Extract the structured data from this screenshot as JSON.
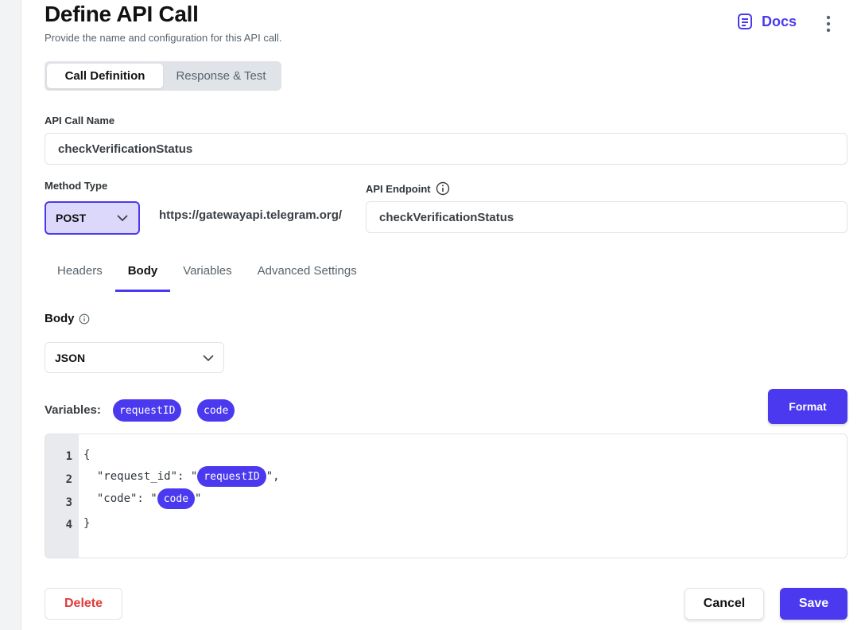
{
  "header": {
    "title": "Define API Call",
    "subtitle": "Provide the name and configuration for this API call.",
    "docs_label": "Docs"
  },
  "main_tabs": [
    {
      "label": "Call Definition",
      "active": true
    },
    {
      "label": "Response & Test",
      "active": false
    }
  ],
  "api_call_name": {
    "label": "API Call Name",
    "value": "checkVerificationStatus"
  },
  "method": {
    "label": "Method Type",
    "value": "POST"
  },
  "base_url": "https://gatewayapi.telegram.org/",
  "endpoint": {
    "label": "API Endpoint",
    "value": "checkVerificationStatus"
  },
  "sub_tabs": [
    {
      "label": "Headers",
      "active": false
    },
    {
      "label": "Body",
      "active": true
    },
    {
      "label": "Variables",
      "active": false
    },
    {
      "label": "Advanced Settings",
      "active": false
    }
  ],
  "body": {
    "label": "Body",
    "type_value": "JSON",
    "variables_label": "Variables:",
    "variables": [
      "requestID",
      "code"
    ],
    "format_label": "Format",
    "editor": {
      "line_numbers": [
        "1",
        "2",
        "3",
        "4"
      ],
      "line1": "{",
      "line2_prefix": "  \"request_id\": \"",
      "line2_var": "requestID",
      "line2_suffix": "\",",
      "line3_prefix": "  \"code\": \"",
      "line3_var": "code",
      "line3_suffix": "\"",
      "line4": "}"
    }
  },
  "footer": {
    "delete_label": "Delete",
    "cancel_label": "Cancel",
    "save_label": "Save"
  },
  "colors": {
    "accent": "#4b39ef",
    "danger": "#e03b3b"
  },
  "icons": {
    "docs": "document-list-icon",
    "more": "kebab-menu-icon",
    "info": "info-icon",
    "chevron": "chevron-down-icon"
  }
}
